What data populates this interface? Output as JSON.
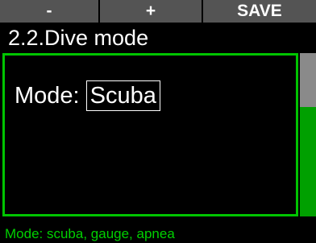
{
  "buttons": {
    "minus": "-",
    "plus": "+",
    "save": "SAVE"
  },
  "title": "2.2.Dive mode",
  "setting": {
    "label": "Mode:",
    "value": "Scuba"
  },
  "hint": "Mode: scuba, gauge, apnea",
  "colors": {
    "background": "#000000",
    "button": "#545454",
    "accent": "#00c400",
    "scroll_track": "#00a000",
    "scroll_thumb": "#8a8a8a",
    "hint_text": "#00d000"
  },
  "scroll": {
    "position_fraction": 0.0,
    "visible_fraction": 0.33
  }
}
